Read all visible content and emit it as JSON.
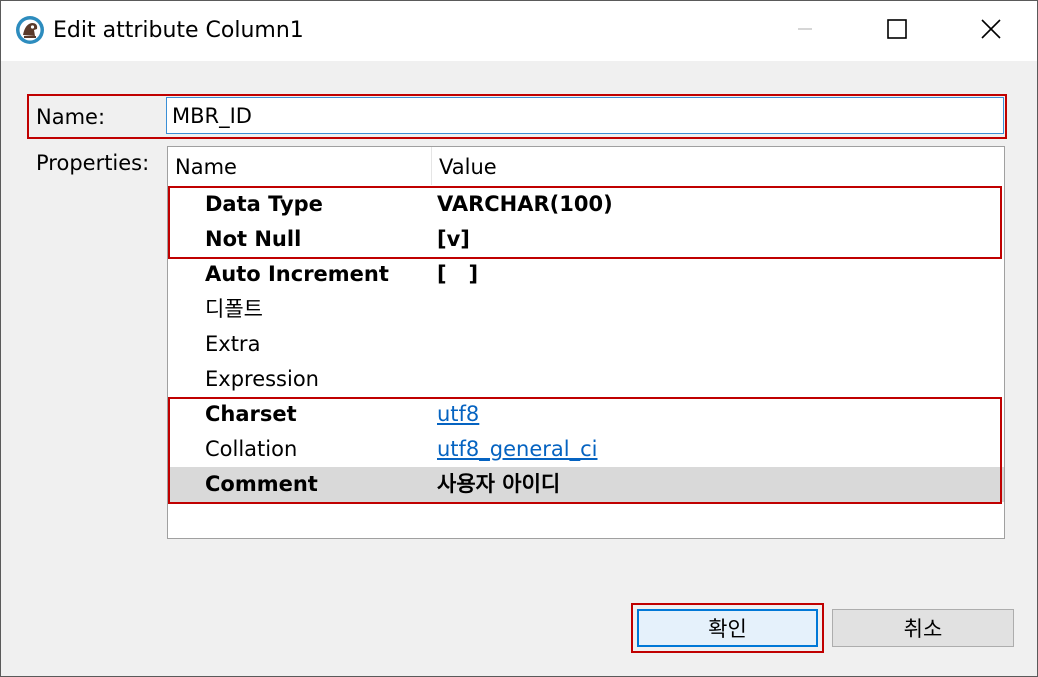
{
  "window": {
    "title": "Edit attribute Column1",
    "app_icon": "dbeaver-icon",
    "controls": {
      "minimize_icon": "minimize-icon",
      "maximize_icon": "maximize-icon",
      "close_icon": "close-icon"
    }
  },
  "form": {
    "name_label": "Name:",
    "name_value": "MBR_ID",
    "properties_label": "Properties:"
  },
  "table": {
    "columns": [
      "Name",
      "Value"
    ],
    "rows": [
      {
        "name": "Data Type",
        "value": "VARCHAR(100)",
        "bold": true
      },
      {
        "name": "Not Null",
        "value": "[v]",
        "bold": true
      },
      {
        "name": "Auto Increment",
        "value": "[   ]",
        "bold": true
      },
      {
        "name": "디폴트",
        "value": "",
        "bold": false
      },
      {
        "name": "Extra",
        "value": "",
        "bold": false
      },
      {
        "name": "Expression",
        "value": "",
        "bold": false
      },
      {
        "name": "Charset",
        "value": "utf8",
        "bold": true,
        "link": true
      },
      {
        "name": "Collation",
        "value": "utf8_general_ci",
        "bold": false,
        "link": true
      },
      {
        "name": "Comment",
        "value": "사용자 아이디",
        "bold": true,
        "selected": true
      }
    ]
  },
  "buttons": {
    "ok_label": "확인",
    "cancel_label": "취소"
  },
  "colors": {
    "highlight": "#c00000",
    "link": "#0563c1",
    "focus": "#0078d7",
    "selected_row": "#d9d9d9"
  }
}
